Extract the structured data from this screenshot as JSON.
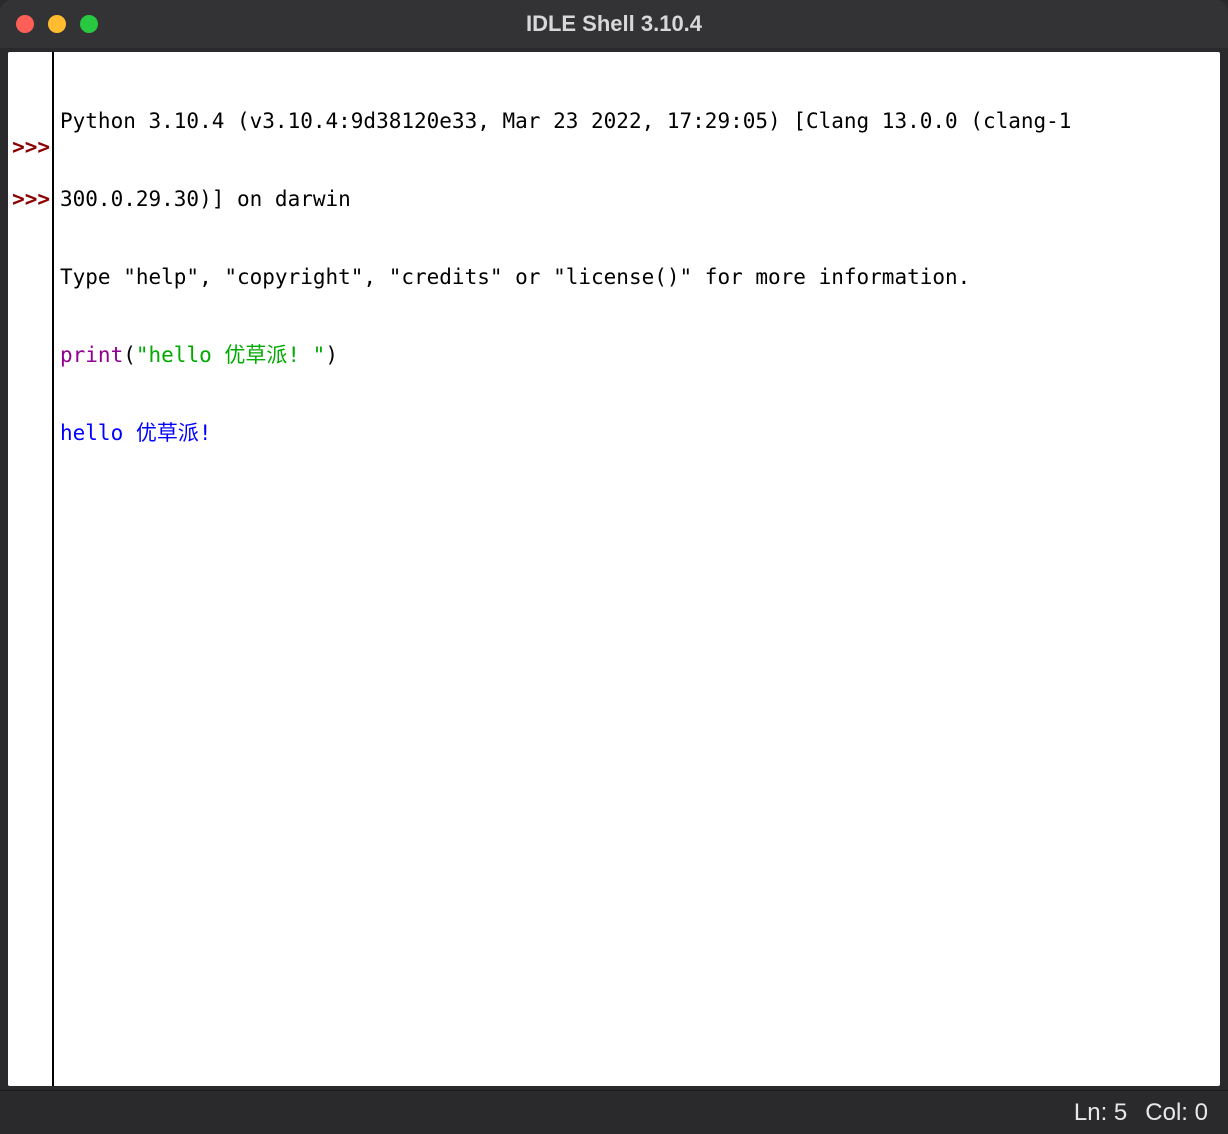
{
  "window": {
    "title": "IDLE Shell 3.10.4"
  },
  "shell": {
    "banner_line1": "Python 3.10.4 (v3.10.4:9d38120e33, Mar 23 2022, 17:29:05) [Clang 13.0.0 (clang-1",
    "banner_line2": "300.0.29.30)] on darwin",
    "banner_line3": "Type \"help\", \"copyright\", \"credits\" or \"license()\" for more information.",
    "prompt": ">>>",
    "input_builtin": "print",
    "input_open_paren": "(",
    "input_string": "\"hello 优草派! \"",
    "input_close_paren": ")",
    "output": "hello 优草派!"
  },
  "status": {
    "line_label": "Ln:",
    "line_value": "5",
    "col_label": "Col:",
    "col_value": "0"
  }
}
